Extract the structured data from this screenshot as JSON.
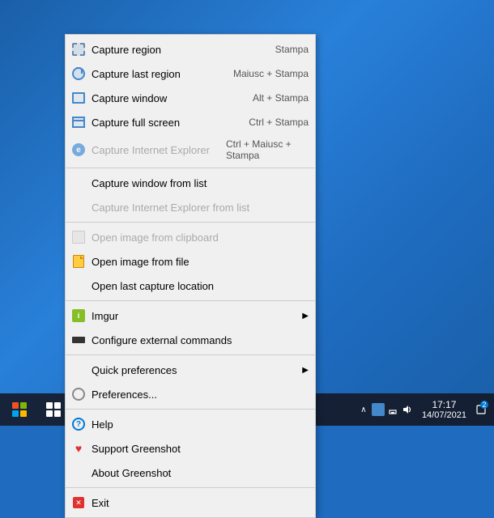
{
  "desktop": {
    "background": "#1e6bbf"
  },
  "context_menu": {
    "items": [
      {
        "id": "capture-region",
        "label": "Capture region",
        "shortcut": "Stampa",
        "icon": "region-icon",
        "disabled": false,
        "has_arrow": false
      },
      {
        "id": "capture-last-region",
        "label": "Capture last region",
        "shortcut": "Maiusc + Stampa",
        "icon": "capture-last-icon",
        "disabled": false,
        "has_arrow": false
      },
      {
        "id": "capture-window",
        "label": "Capture window",
        "shortcut": "Alt + Stampa",
        "icon": "window-icon",
        "disabled": false,
        "has_arrow": false
      },
      {
        "id": "capture-full-screen",
        "label": "Capture full screen",
        "shortcut": "Ctrl + Stampa",
        "icon": "fullscreen-icon",
        "disabled": false,
        "has_arrow": false
      },
      {
        "id": "capture-internet-explorer",
        "label": "Capture Internet Explorer",
        "shortcut": "Ctrl + Maiusc + Stampa",
        "icon": "ie-icon",
        "disabled": true,
        "has_arrow": false
      },
      {
        "id": "separator1",
        "type": "separator"
      },
      {
        "id": "capture-window-from-list",
        "label": "Capture window from list",
        "shortcut": "",
        "icon": null,
        "disabled": false,
        "has_arrow": false
      },
      {
        "id": "capture-ie-from-list",
        "label": "Capture Internet Explorer from list",
        "shortcut": "",
        "icon": null,
        "disabled": true,
        "has_arrow": false
      },
      {
        "id": "separator2",
        "type": "separator"
      },
      {
        "id": "open-image-clipboard",
        "label": "Open image from clipboard",
        "shortcut": "",
        "icon": "image-clipboard-icon",
        "disabled": true,
        "has_arrow": false
      },
      {
        "id": "open-image-file",
        "label": "Open image from file",
        "shortcut": "",
        "icon": "image-file-icon",
        "disabled": false,
        "has_arrow": false
      },
      {
        "id": "open-last-capture",
        "label": "Open last capture location",
        "shortcut": "",
        "icon": null,
        "disabled": false,
        "has_arrow": false
      },
      {
        "id": "separator3",
        "type": "separator"
      },
      {
        "id": "imgur",
        "label": "Imgur",
        "shortcut": "",
        "icon": "imgur-icon",
        "disabled": false,
        "has_arrow": true
      },
      {
        "id": "configure-external",
        "label": "Configure external commands",
        "shortcut": "",
        "icon": "configure-icon",
        "disabled": false,
        "has_arrow": false
      },
      {
        "id": "separator4",
        "type": "separator"
      },
      {
        "id": "quick-preferences",
        "label": "Quick preferences",
        "shortcut": "",
        "icon": null,
        "disabled": false,
        "has_arrow": true
      },
      {
        "id": "preferences",
        "label": "Preferences...",
        "shortcut": "",
        "icon": "prefs-icon",
        "disabled": false,
        "has_arrow": false
      },
      {
        "id": "separator5",
        "type": "separator"
      },
      {
        "id": "help",
        "label": "Help",
        "shortcut": "",
        "icon": "help-icon",
        "disabled": false,
        "has_arrow": false
      },
      {
        "id": "support",
        "label": "Support Greenshot",
        "shortcut": "",
        "icon": "heart-icon",
        "disabled": false,
        "has_arrow": false
      },
      {
        "id": "about",
        "label": "About Greenshot",
        "shortcut": "",
        "icon": null,
        "disabled": false,
        "has_arrow": false
      },
      {
        "id": "separator6",
        "type": "separator"
      },
      {
        "id": "exit",
        "label": "Exit",
        "shortcut": "",
        "icon": "exit-icon",
        "disabled": false,
        "has_arrow": false
      }
    ]
  },
  "taskbar": {
    "clock": {
      "time": "17:17",
      "date": "14/07/2021"
    },
    "notification_count": "2"
  }
}
